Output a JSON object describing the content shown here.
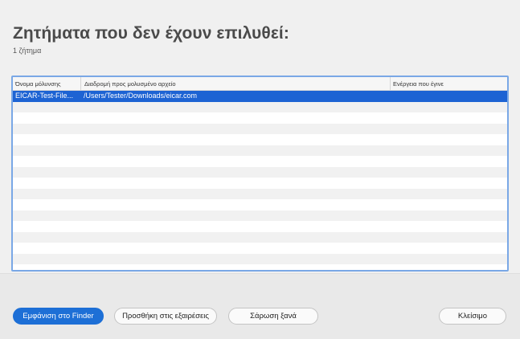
{
  "header": {
    "title": "Ζητήματα που δεν έχουν επιλυθεί:",
    "subtitle": "1 ζήτημα"
  },
  "table": {
    "columns": [
      "Όνομα μόλυνσης",
      "Διαδρομή προς μολυσμένο αρχείο",
      "Ενέργεια που έγινε"
    ],
    "rows": [
      {
        "name": "EICAR-Test-File...",
        "path": "/Users/Tester/Downloads/eicar.com",
        "action": ""
      }
    ]
  },
  "buttons": {
    "show_in_finder": "Εμφάνιση στο Finder",
    "add_to_exclusions": "Προσθήκη στις εξαιρέσεις",
    "rescan": "Σάρωση ξανά",
    "close": "Κλείσιμο"
  },
  "colors": {
    "accent": "#1d6fd6",
    "selection": "#1d63d3",
    "table_border": "#7aa8e6"
  }
}
